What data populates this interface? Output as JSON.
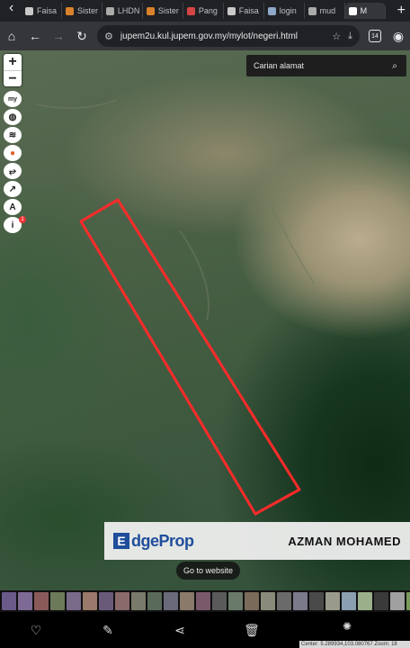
{
  "browser": {
    "tabs": [
      {
        "label": "Faisa",
        "color": "#c9c9c9"
      },
      {
        "label": "Sister",
        "color": "#d9822b"
      },
      {
        "label": "LHDN",
        "color": "#aaaaaa"
      },
      {
        "label": "Sister",
        "color": "#d9822b"
      },
      {
        "label": "Pang",
        "color": "#d64545"
      },
      {
        "label": "Faisa",
        "color": "#c9c9c9"
      },
      {
        "label": "login",
        "color": "#8fa7c9"
      },
      {
        "label": "mud",
        "color": "#aaaaaa"
      },
      {
        "label": "M",
        "color": "#ffffff"
      }
    ],
    "url": "jupem2u.kul.jupem.gov.my/mylot/negeri.html",
    "tab_count": "14"
  },
  "map": {
    "search_placeholder": "Carian alamat",
    "zoom_in": "+",
    "zoom_out": "−",
    "tools": [
      "myLot",
      "globe",
      "layers",
      "location",
      "route",
      "measure",
      "draw",
      "info"
    ],
    "info_badge": "1"
  },
  "watermark": {
    "brand_mark": "E",
    "brand_name": "dgeProp",
    "agent_name": "AZMAN MOHAMED"
  },
  "goto_button": "Go to website",
  "status": {
    "coordinates": "Center: 5.289934,103.080767   Zoom: 18"
  },
  "thumbnails": [
    "#6a5a8a",
    "#7d6b95",
    "#8a5a5a",
    "#6d7a5a",
    "#7a6a8a",
    "#9a7a6a",
    "#6a5a7a",
    "#8a6a6a",
    "#7a7a6a",
    "#5a6a5a",
    "#6a6a7a",
    "#8a7a6a",
    "#7a5a6a",
    "#5a5a5a",
    "#6a7a6a",
    "#7a6a5a",
    "#8a8a7a",
    "#6a6a6a",
    "#7a7a8a",
    "#4a4a4a",
    "#9a9a8a",
    "#8aa0b0",
    "#9ab08a",
    "#3a3a3a",
    "#a0a0a0",
    "#7a9a5a"
  ],
  "colors": {
    "boundary": "#ff2a2a"
  }
}
